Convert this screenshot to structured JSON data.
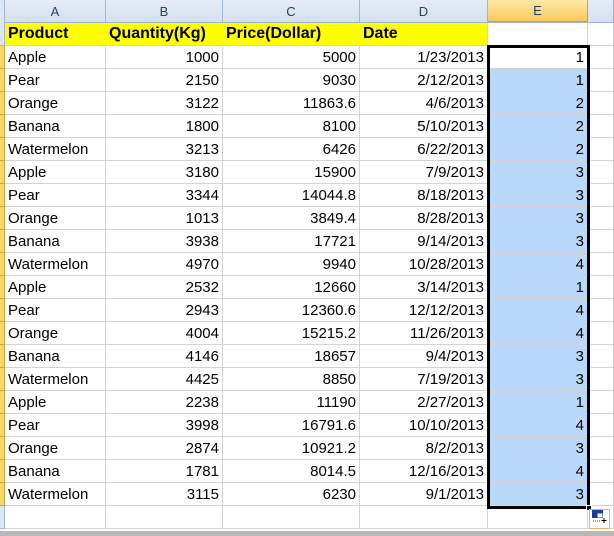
{
  "columns": [
    "A",
    "B",
    "C",
    "D",
    "E"
  ],
  "active_column": "E",
  "header_row": {
    "product": "Product",
    "quantity": "Quantity(Kg)",
    "price": "Price(Dollar)",
    "date": "Date",
    "e": ""
  },
  "rows": [
    {
      "product": "Apple",
      "quantity": "1000",
      "price": "5000",
      "date": "1/23/2013",
      "quarter": "1"
    },
    {
      "product": "Pear",
      "quantity": "2150",
      "price": "9030",
      "date": "2/12/2013",
      "quarter": "1"
    },
    {
      "product": "Orange",
      "quantity": "3122",
      "price": "11863.6",
      "date": "4/6/2013",
      "quarter": "2"
    },
    {
      "product": "Banana",
      "quantity": "1800",
      "price": "8100",
      "date": "5/10/2013",
      "quarter": "2"
    },
    {
      "product": "Watermelon",
      "quantity": "3213",
      "price": "6426",
      "date": "6/22/2013",
      "quarter": "2"
    },
    {
      "product": "Apple",
      "quantity": "3180",
      "price": "15900",
      "date": "7/9/2013",
      "quarter": "3"
    },
    {
      "product": "Pear",
      "quantity": "3344",
      "price": "14044.8",
      "date": "8/18/2013",
      "quarter": "3"
    },
    {
      "product": "Orange",
      "quantity": "1013",
      "price": "3849.4",
      "date": "8/28/2013",
      "quarter": "3"
    },
    {
      "product": "Banana",
      "quantity": "3938",
      "price": "17721",
      "date": "9/14/2013",
      "quarter": "3"
    },
    {
      "product": "Watermelon",
      "quantity": "4970",
      "price": "9940",
      "date": "10/28/2013",
      "quarter": "4"
    },
    {
      "product": "Apple",
      "quantity": "2532",
      "price": "12660",
      "date": "3/14/2013",
      "quarter": "1"
    },
    {
      "product": "Pear",
      "quantity": "2943",
      "price": "12360.6",
      "date": "12/12/2013",
      "quarter": "4"
    },
    {
      "product": "Orange",
      "quantity": "4004",
      "price": "15215.2",
      "date": "11/26/2013",
      "quarter": "4"
    },
    {
      "product": "Banana",
      "quantity": "4146",
      "price": "18657",
      "date": "9/4/2013",
      "quarter": "3"
    },
    {
      "product": "Watermelon",
      "quantity": "4425",
      "price": "8850",
      "date": "7/19/2013",
      "quarter": "3"
    },
    {
      "product": "Apple",
      "quantity": "2238",
      "price": "11190",
      "date": "2/27/2013",
      "quarter": "1"
    },
    {
      "product": "Pear",
      "quantity": "3998",
      "price": "16791.6",
      "date": "10/10/2013",
      "quarter": "4"
    },
    {
      "product": "Orange",
      "quantity": "2874",
      "price": "10921.2",
      "date": "8/2/2013",
      "quarter": "3"
    },
    {
      "product": "Banana",
      "quantity": "1781",
      "price": "8014.5",
      "date": "12/16/2013",
      "quarter": "4"
    },
    {
      "product": "Watermelon",
      "quantity": "3115",
      "price": "6230",
      "date": "9/1/2013",
      "quarter": "3"
    }
  ],
  "colors": {
    "header_fill": "#ffff00",
    "selection_fill": "#bad8f9",
    "active_column_header": "#f9c95b"
  },
  "icons": {
    "autofill_options": "auto-fill-options-icon"
  }
}
